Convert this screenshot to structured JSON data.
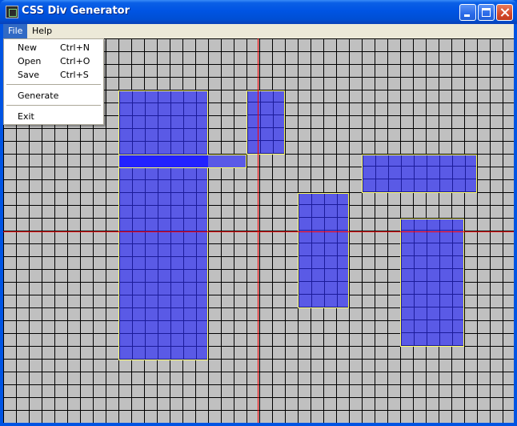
{
  "window": {
    "title": "CSS Div Generator",
    "icon": "app-icon",
    "controls": [
      "minimize-icon",
      "maximize-icon",
      "close-icon"
    ]
  },
  "menubar": {
    "file": "File",
    "help": "Help"
  },
  "file_menu": {
    "new": {
      "label": "New",
      "shortcut": "Ctrl+N"
    },
    "open": {
      "label": "Open",
      "shortcut": "Ctrl+O"
    },
    "save": {
      "label": "Save",
      "shortcut": "Ctrl+S"
    },
    "generate": {
      "label": "Generate"
    },
    "exit": {
      "label": "Exit"
    }
  },
  "colors": {
    "canvas_background": "#c0c0c0",
    "grid_lines": "#000000",
    "div_fill": "#5a5ae6",
    "div_border": "#ffff66",
    "selected_div_fill": "#2222ff",
    "guide_lines": "#ff0000",
    "titlebar": "#0054e3",
    "menu_highlight": "#316ac5"
  },
  "canvas": {
    "div_count": 6
  }
}
